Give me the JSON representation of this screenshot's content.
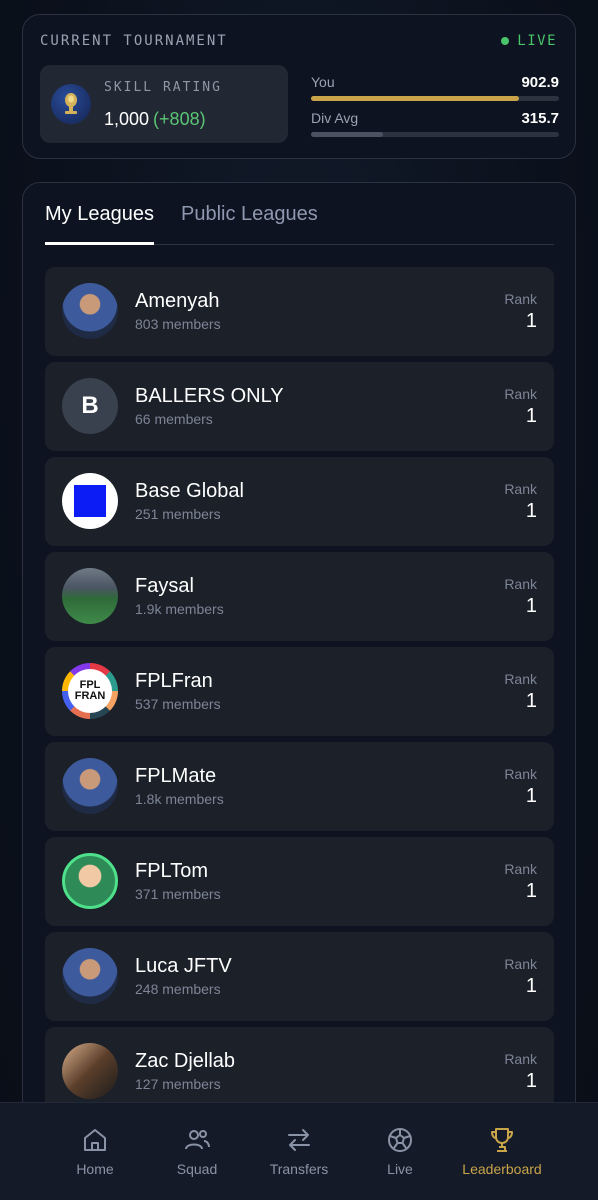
{
  "tournament": {
    "title": "CURRENT TOURNAMENT",
    "status": "LIVE",
    "skill_label": "SKILL RATING",
    "skill_value": "1,000",
    "skill_delta": "(+808)",
    "you_label": "You",
    "you_value": "902.9",
    "you_progress": 0.84,
    "div_label": "Div Avg",
    "div_value": "315.7",
    "div_progress": 0.29
  },
  "tabs": {
    "my_leagues": "My Leagues",
    "public_leagues": "Public Leagues"
  },
  "leagues": [
    {
      "name": "Amenyah",
      "members": "803 members",
      "rank_label": "Rank",
      "rank": "1",
      "avatar": "photo-person"
    },
    {
      "name": "BALLERS ONLY",
      "members": "66 members",
      "rank_label": "Rank",
      "rank": "1",
      "avatar": "letter",
      "letter": "B"
    },
    {
      "name": "Base Global",
      "members": "251 members",
      "rank_label": "Rank",
      "rank": "1",
      "avatar": "blue-square"
    },
    {
      "name": "Faysal",
      "members": "1.9k members",
      "rank_label": "Rank",
      "rank": "1",
      "avatar": "photo-stadium"
    },
    {
      "name": "FPLFran",
      "members": "537 members",
      "rank_label": "Rank",
      "rank": "1",
      "avatar": "logo-fplfran",
      "logo_text_1": "FPL",
      "logo_text_2": "FRAN"
    },
    {
      "name": "FPLMate",
      "members": "1.8k members",
      "rank_label": "Rank",
      "rank": "1",
      "avatar": "photo-person"
    },
    {
      "name": "FPLTom",
      "members": "371 members",
      "rank_label": "Rank",
      "rank": "1",
      "avatar": "photo-person-green"
    },
    {
      "name": "Luca JFTV",
      "members": "248 members",
      "rank_label": "Rank",
      "rank": "1",
      "avatar": "photo-person"
    },
    {
      "name": "Zac Djellab",
      "members": "127 members",
      "rank_label": "Rank",
      "rank": "1",
      "avatar": "photo-group"
    }
  ],
  "nav": [
    {
      "label": "Home",
      "icon": "home-icon",
      "active": false
    },
    {
      "label": "Squad",
      "icon": "squad-icon",
      "active": false
    },
    {
      "label": "Transfers",
      "icon": "transfers-icon",
      "active": false
    },
    {
      "label": "Live",
      "icon": "live-ball-icon",
      "active": false
    },
    {
      "label": "Leaderboard",
      "icon": "trophy-icon",
      "active": true
    }
  ],
  "colors": {
    "accent_gold": "#c9a449",
    "live_green": "#49c46a",
    "delta_green": "#5bc475"
  }
}
